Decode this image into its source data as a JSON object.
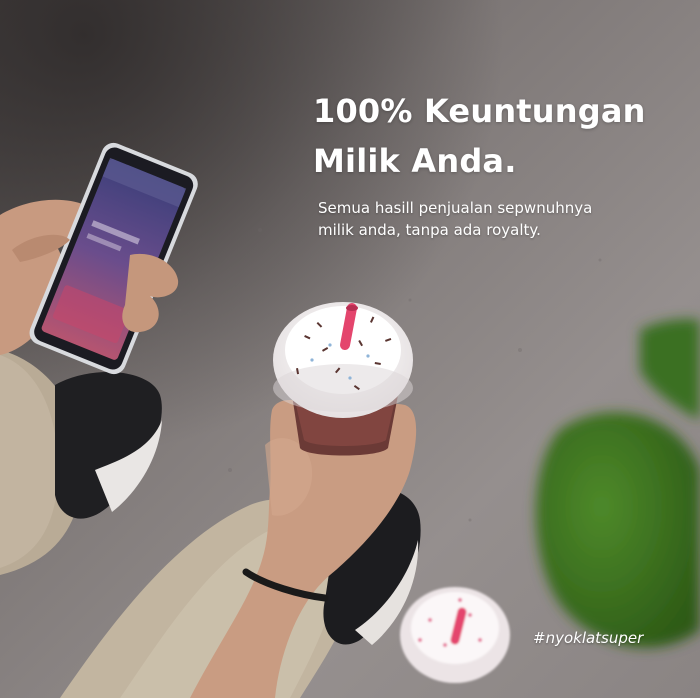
{
  "headline": {
    "line1": "100% Keuntungan",
    "line2": "Milik Anda."
  },
  "subtext": {
    "line1": "Semua hasill penjualan sepwnuhnya",
    "line2": "milik anda, tanpa ada royalty."
  },
  "hashtag": "#nyoklatsuper"
}
